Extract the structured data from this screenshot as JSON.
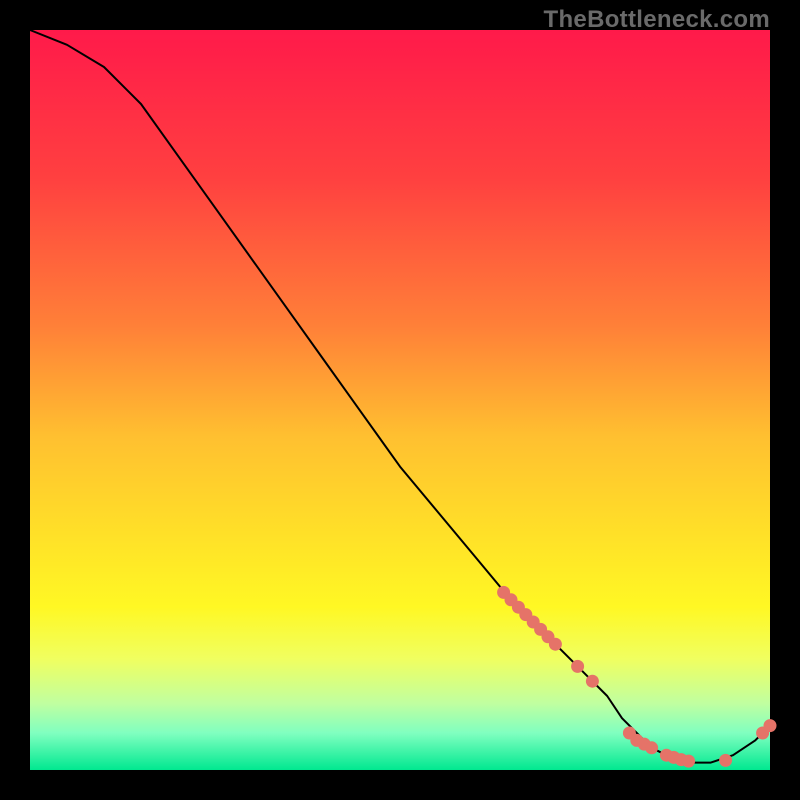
{
  "watermark": "TheBottleneck.com",
  "colors": {
    "background": "#000000",
    "gradient_top": "#ff1a4a",
    "gradient_bottom": "#00e890",
    "curve": "#000000",
    "marker": "#e57368"
  },
  "chart_data": {
    "type": "line",
    "title": "",
    "xlabel": "",
    "ylabel": "",
    "xlim": [
      0,
      100
    ],
    "ylim": [
      0,
      100
    ],
    "series": [
      {
        "name": "curve",
        "x": [
          0,
          5,
          10,
          15,
          20,
          25,
          30,
          35,
          40,
          45,
          50,
          55,
          60,
          65,
          70,
          75,
          78,
          80,
          82,
          84,
          86,
          88,
          90,
          92,
          95,
          98,
          100
        ],
        "y": [
          100,
          98,
          95,
          90,
          83,
          76,
          69,
          62,
          55,
          48,
          41,
          35,
          29,
          23,
          18,
          13,
          10,
          7,
          5,
          3,
          2,
          1,
          1,
          1,
          2,
          4,
          6
        ]
      }
    ],
    "markers": {
      "name": "highlight-points",
      "x": [
        64,
        65,
        66,
        67,
        68,
        69,
        70,
        71,
        74,
        76,
        81,
        82,
        83,
        84,
        86,
        87,
        88,
        89,
        94,
        99,
        100
      ],
      "y": [
        24,
        23,
        22,
        21,
        20,
        19,
        18,
        17,
        14,
        12,
        5,
        4,
        3.5,
        3,
        2,
        1.7,
        1.4,
        1.2,
        1.3,
        5,
        6
      ]
    }
  }
}
